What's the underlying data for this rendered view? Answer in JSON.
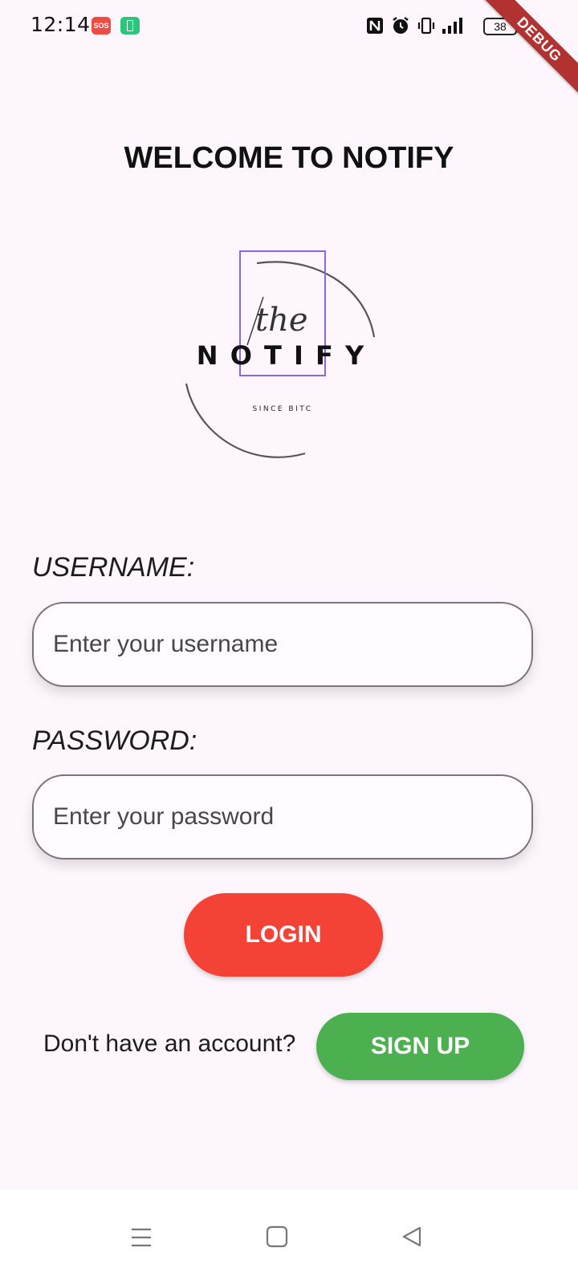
{
  "status_bar": {
    "time": "12:14",
    "sos": "SOS",
    "battery_level": "38",
    "icons": [
      "sos-icon",
      "battery-saver-icon",
      "nfc-icon",
      "alarm-icon",
      "vibrate-icon",
      "signal-icon",
      "battery-icon",
      "charging-icon"
    ]
  },
  "debug_banner": "DEBUG",
  "page": {
    "title": "WELCOME TO NOTIFY"
  },
  "logo": {
    "script": "the",
    "wordmark": "N O T I F Y",
    "tagline": "SINCE BITC"
  },
  "form": {
    "username_label": "USERNAME:",
    "username_placeholder": "Enter your username",
    "username_value": "",
    "password_label": "PASSWORD:",
    "password_placeholder": "Enter your password",
    "password_value": "",
    "login_label": "LOGIN",
    "signup_prompt": "Don't have an account?",
    "signup_label": "SIGN UP"
  },
  "colors": {
    "background": "#fdf7fd",
    "login": "#f44336",
    "signup": "#4caf50",
    "debug": "#b23232"
  },
  "nav_bar": {
    "icons": [
      "menu-icon",
      "home-icon",
      "back-icon"
    ]
  }
}
